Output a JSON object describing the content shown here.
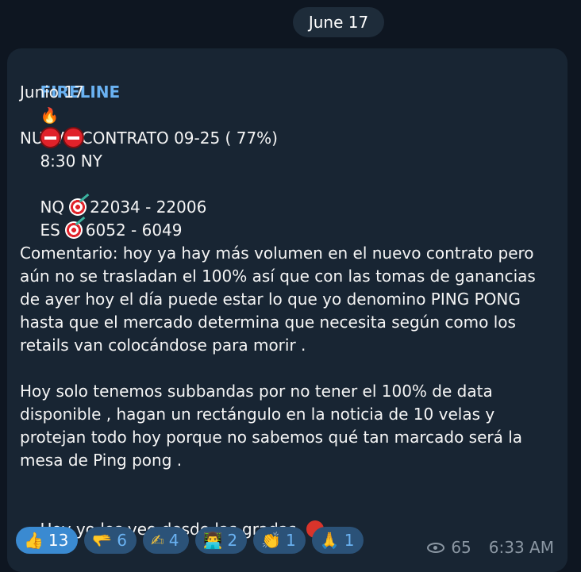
{
  "date_pill": "June 17",
  "message": {
    "sender": "FIRELINE",
    "sender_emoji": "🔥",
    "lines": {
      "date": "Junio 17",
      "time": "8:30 NY",
      "contract": "NUEVO CONTRATO 09-25 ( 77%)",
      "nq_label": "NQ",
      "nq_range": "22034 - 22006",
      "es_label": "ES",
      "es_range": "6052 - 6049",
      "comment": "Comentario: hoy ya hay más volumen en el nuevo contrato pero aún no se trasladan el 100% así que con las tomas de ganancias de ayer hoy el día puede estar lo que yo denomino  PING PONG hasta que el mercado determina que necesita según como los retails van colocándose para morir .",
      "subbands": "Hoy solo tenemos subbandas por no tener el 100% de data disponible , hagan un rectángulo en la noticia de 10 velas y protejan todo hoy porque no sabemos qué tan marcado será la mesa de Ping pong .",
      "closing": "Hoy yo los veo desde las gradas",
      "closing_end": "."
    },
    "icons": {
      "stop": "stop-sign-icon",
      "target": "direct-hit-icon",
      "paddle": "ping-pong-icon"
    }
  },
  "reactions": [
    {
      "emoji": "👍",
      "count": "13",
      "active": true
    },
    {
      "emoji": "🫳",
      "count": "6",
      "active": false
    },
    {
      "emoji": "✍",
      "count": "4",
      "active": false
    },
    {
      "emoji": "👨‍💻",
      "count": "2",
      "active": false
    },
    {
      "emoji": "👏",
      "count": "1",
      "active": false
    },
    {
      "emoji": "🙏",
      "count": "1",
      "active": false
    }
  ],
  "meta": {
    "views": "65",
    "time": "6:33 AM"
  },
  "colors": {
    "background": "#0e1621",
    "bubble": "#182533",
    "sender": "#6ab2f2",
    "reaction_active": "#3a8ad1",
    "reaction": "#2b5278"
  }
}
